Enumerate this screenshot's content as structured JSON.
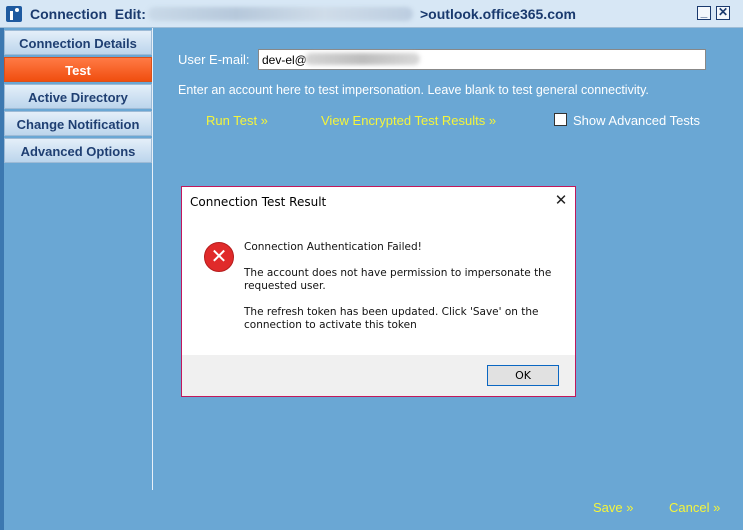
{
  "window": {
    "title_prefix": "Connection  Edit:",
    "title_host": ">outlook.office365.com",
    "minimize_label": "_",
    "close_label": "✕"
  },
  "sidebar": {
    "items": [
      {
        "label": "Connection Details",
        "active": false
      },
      {
        "label": "Test",
        "active": true
      },
      {
        "label": "Active Directory",
        "active": false
      },
      {
        "label": "Change Notification",
        "active": false
      },
      {
        "label": "Advanced Options",
        "active": false
      }
    ]
  },
  "test": {
    "email_label": "User E-mail:",
    "email_value": "dev-el@",
    "hint": "Enter an account here to test impersonation. Leave blank to test general connectivity.",
    "run_test": "Run Test »",
    "view_encrypted": "View Encrypted Test Results »",
    "show_advanced": "Show Advanced Tests",
    "show_advanced_checked": false
  },
  "dialog": {
    "title": "Connection Test Result",
    "close_glyph": "✕",
    "error_glyph": "✕",
    "messages": [
      "Connection Authentication Failed!",
      "The account does not have permission to impersonate the requested user.",
      "The refresh token has been updated. Click 'Save' on the connection to activate this token"
    ],
    "ok_label": "OK"
  },
  "footer": {
    "save_label": "Save »",
    "cancel_label": "Cancel »"
  },
  "colors": {
    "background": "#6aa7d4",
    "active_tab": "#f04e0f",
    "link": "#f5f53a",
    "dialog_border": "#c2185b",
    "error": "#e02a2a"
  }
}
